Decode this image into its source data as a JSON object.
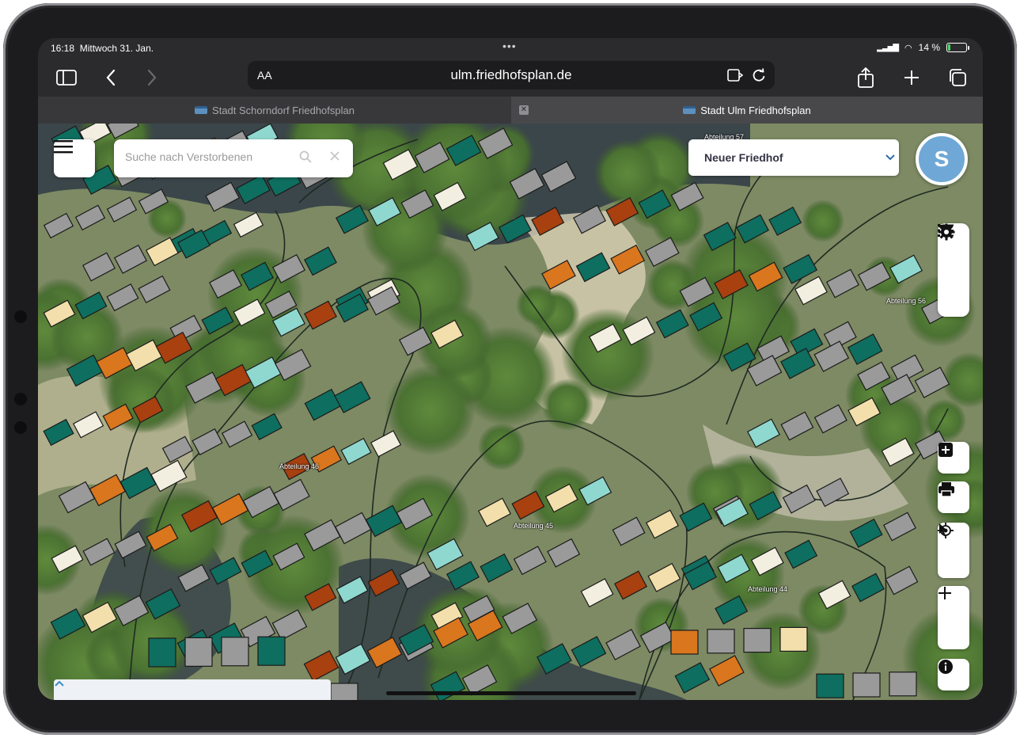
{
  "status_bar": {
    "time": "16:18",
    "date": "Mittwoch 31. Jan.",
    "battery_percent": "14 %",
    "battery_level": 0.14
  },
  "browser": {
    "text_size_label": "AA",
    "url": "ulm.friedhofsplan.de",
    "tabs": [
      {
        "title": "Stadt Schorndorf Friedhofsplan",
        "active": false
      },
      {
        "title": "Stadt Ulm Friedhofsplan",
        "active": true
      }
    ],
    "icons": [
      "sidebar-icon",
      "back-icon",
      "forward-icon",
      "reader-icon",
      "reload-icon",
      "share-icon",
      "new-tab-icon",
      "tabs-overview-icon"
    ]
  },
  "app": {
    "search_placeholder": "Suche nach Verstorbenen",
    "cemetery": "Neuer Friedhof",
    "user_initial": "S",
    "accent_color": "#2c6ea8",
    "section_labels": [
      "Abteilung 46",
      "Abteilung 45",
      "Abteilung 44",
      "Abteilung 56",
      "Abteilung 57"
    ]
  },
  "grave_colors": {
    "occupied": "#0e6e5f",
    "free": "#9a9a9a",
    "reserved": "#d9761e",
    "expiring": "#a8400f",
    "available": "#f3efe0",
    "light": "#8fd8cf",
    "cream": "#f2dfab"
  }
}
